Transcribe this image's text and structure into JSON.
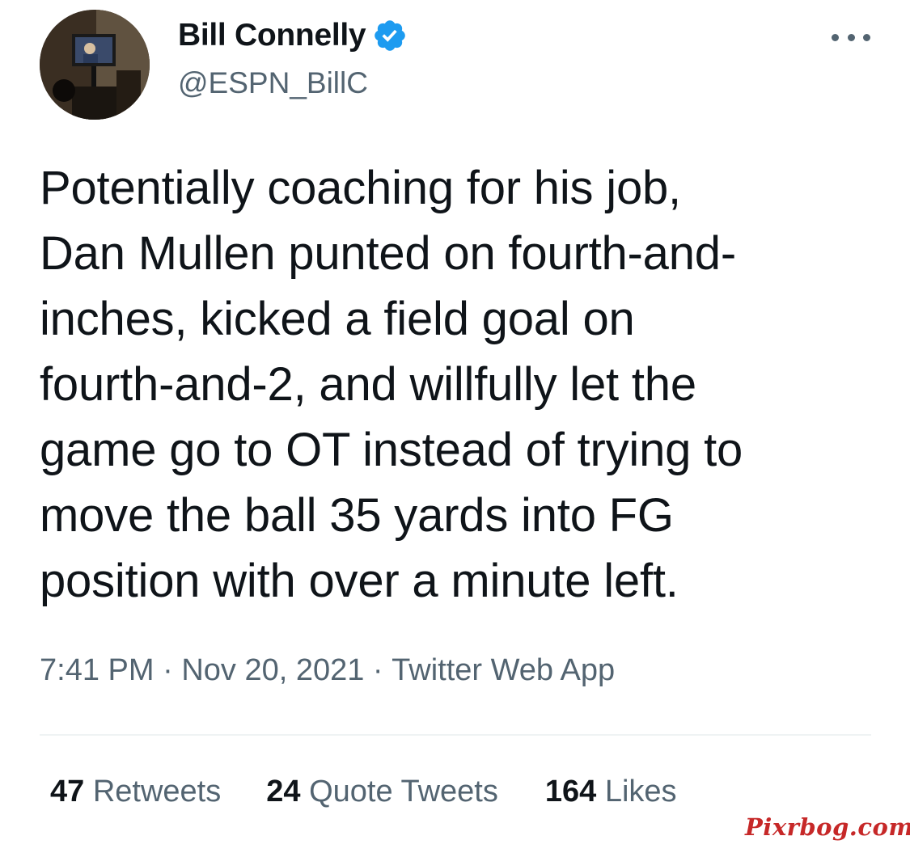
{
  "author": {
    "display_name": "Bill Connelly",
    "handle": "@ESPN_BillC",
    "verified": true,
    "avatar_icon": "profile-photo",
    "verified_icon": "verified-badge-icon"
  },
  "menu": {
    "icon": "more-options-icon"
  },
  "tweet": {
    "lines": [
      "Potentially coaching for his job,",
      "Dan Mullen punted on fourth-and-",
      "inches, kicked a field goal on",
      "fourth-and-2, and willfully let the",
      "game go to OT instead of trying to",
      "move the ball 35 yards into FG",
      "position with over a minute left."
    ]
  },
  "meta": {
    "time": "7:41 PM",
    "separator": " · ",
    "date": "Nov 20, 2021",
    "source": "Twitter Web App"
  },
  "stats": {
    "retweets": {
      "count": "47",
      "label": " Retweets"
    },
    "quotes": {
      "count": "24",
      "label": " Quote Tweets"
    },
    "likes": {
      "count": "164",
      "label": " Likes"
    }
  },
  "watermark": "Pixrbog.com",
  "colors": {
    "text_primary": "#0f1419",
    "text_secondary": "#536471",
    "verified_blue": "#1d9bf0",
    "divider": "#eff3f4",
    "watermark": "#c62828"
  }
}
